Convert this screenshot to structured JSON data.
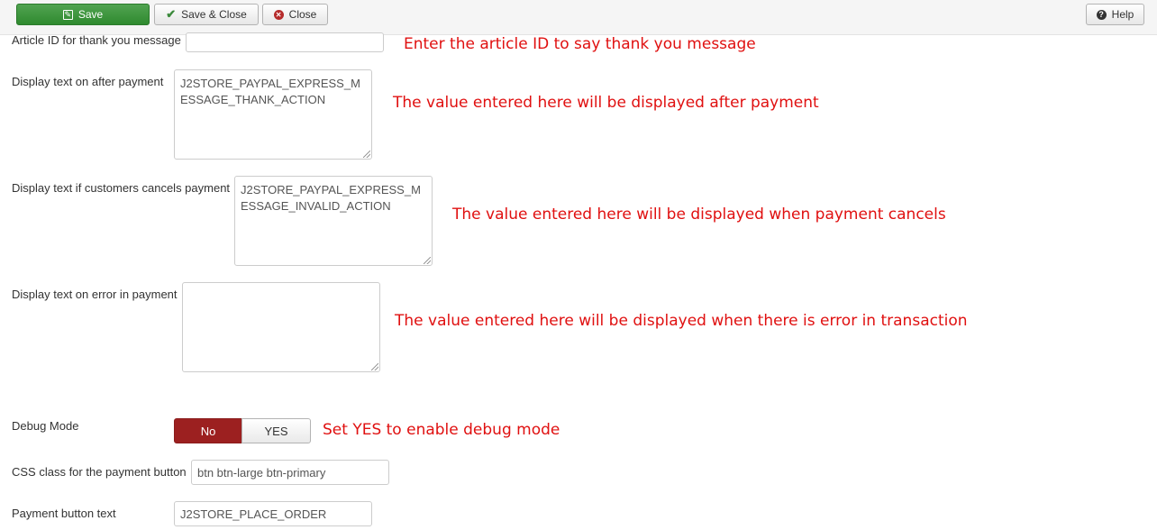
{
  "toolbar": {
    "save_label": "Save",
    "save_close_label": "Save & Close",
    "close_label": "Close",
    "help_label": "Help"
  },
  "fields": {
    "article_id": {
      "label": "Article ID for thank you message",
      "value": "",
      "note": "Enter the article ID to say thank you message"
    },
    "after_payment": {
      "label": "Display text on after payment",
      "value": "J2STORE_PAYPAL_EXPRESS_MESSAGE_THANK_ACTION",
      "note": "The value entered here will be displayed after payment"
    },
    "cancel_payment": {
      "label": "Display text if customers cancels payment",
      "value": "J2STORE_PAYPAL_EXPRESS_MESSAGE_INVALID_ACTION",
      "note": "The value entered here will be displayed when payment cancels"
    },
    "error_payment": {
      "label": "Display text on error in payment",
      "value": "",
      "note": "The value entered here will be displayed when there is error in transaction"
    },
    "debug_mode": {
      "label": "Debug Mode",
      "option_no": "No",
      "option_yes": "YES",
      "selected": "No",
      "note": "Set YES to enable debug mode"
    },
    "css_class": {
      "label": "CSS class for the payment button",
      "value": "btn btn-large btn-primary"
    },
    "button_text": {
      "label": "Payment button text",
      "value": "J2STORE_PLACE_ORDER"
    }
  },
  "colors": {
    "note_red": "#e01010",
    "save_green": "#3d9a3d",
    "toggle_active_red": "#9c2020"
  },
  "icons": {
    "save": "edit-icon",
    "save_close": "check-icon",
    "close": "close-circle-icon",
    "help": "question-circle-icon"
  }
}
